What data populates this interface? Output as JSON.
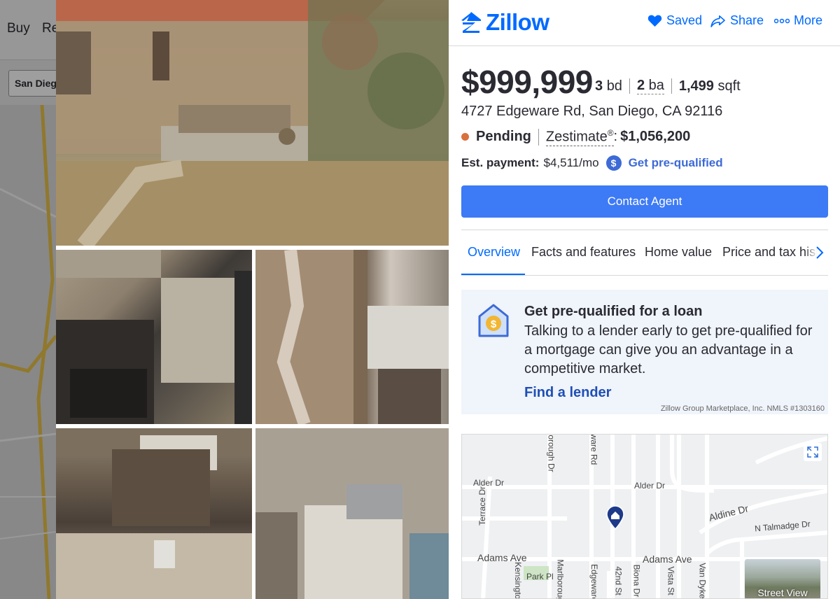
{
  "background": {
    "nav_buy": "Buy",
    "nav_rent": "Re",
    "search_value": "San Diego"
  },
  "header": {
    "logo_text": "Zillow",
    "saved_label": "Saved",
    "share_label": "Share",
    "more_label": "More"
  },
  "listing": {
    "price": "$999,999",
    "beds_num": "3",
    "beds_unit": "bd",
    "baths_num": "2",
    "baths_unit": "ba",
    "sqft_num": "1,499",
    "sqft_unit": "sqft",
    "address": "4727 Edgeware Rd, San Diego, CA 92116",
    "status": "Pending",
    "zestimate_label": "Zestimate",
    "zestimate_sup": "®",
    "zestimate_colon": ":",
    "zestimate_value": "$1,056,200",
    "payment_label": "Est. payment:",
    "payment_value": "$4,511/mo",
    "prequal_link": "Get pre-qualified",
    "contact_button": "Contact Agent"
  },
  "tabs": [
    {
      "label": "Overview"
    },
    {
      "label": "Facts and features"
    },
    {
      "label": "Home value"
    },
    {
      "label": "Price and tax history"
    }
  ],
  "loan_card": {
    "title": "Get pre-qualified for a loan",
    "body": "Talking to a lender early to get pre-qualified for a mortgage can give you an advantage in a competitive market.",
    "link": "Find a lender",
    "nmls": "Zillow Group Marketplace, Inc. NMLS #1303160"
  },
  "map": {
    "labels": [
      "Alder Dr",
      "Alder Dr",
      "Aldine Dr",
      "N Talmadge Dr",
      "Adams Ave",
      "Adams Ave",
      "Park Pl",
      "Terrace Dr",
      "Kensington",
      "Marlborough",
      "Edgeware",
      "42nd St",
      "Biona Dr",
      "Vista St",
      "Van Dyke",
      "orough Dr",
      "ware Rd"
    ],
    "street_view_label": "Street View"
  },
  "colors": {
    "brand_blue": "#006aff",
    "button_blue": "#3d7af5",
    "pending_dot": "#d9703d",
    "card_bg": "#f0f4fb"
  }
}
